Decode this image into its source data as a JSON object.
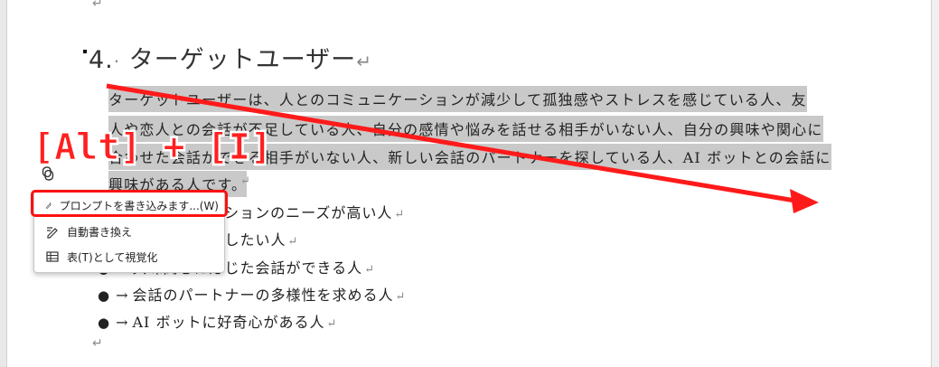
{
  "document": {
    "top_return_mark": "↵",
    "heading": {
      "number": "4.",
      "separator": "·",
      "text": "ターゲットユーザー",
      "return_mark": "↵"
    },
    "paragraph_lines": [
      "ターゲットユーザーは、人とのコミュニケーションが減少して孤独感やストレスを感じている人、友",
      "人や恋人との会話が不足している人、自分の感情や悩みを話せる相手がいない人、自分の興味や関心に",
      "合わせた会話ができる相手がいない人、新しい会話のパートナーを探している人、AI ボットとの会話に",
      "興味がある人です。"
    ],
    "paragraph_end_mark": "↵",
    "list_items": [
      {
        "bullet": "●",
        "arrow": "→",
        "text": "コミュニケーションのニーズが高い人",
        "ret": "↵"
      },
      {
        "bullet": "●",
        "arrow": "→",
        "text": "気持ちを共有したい人",
        "ret": "↵"
      },
      {
        "bullet": "●",
        "arrow": "→",
        "text": "興味関心に応じた会話ができる人",
        "ret": "↵"
      },
      {
        "bullet": "●",
        "arrow": "→",
        "text": "会話のパートナーの多様性を求める人",
        "ret": "↵"
      },
      {
        "bullet": "●",
        "arrow": "→",
        "text": "AI ボットに好奇心がある人",
        "ret": "↵"
      }
    ],
    "bottom_return_mark": "↵"
  },
  "context_menu": {
    "items": [
      {
        "label": "プロンプトを書き込みます...(W)",
        "icon": "pen-sparkle-icon"
      },
      {
        "label": "自動書き換え",
        "icon": "pen-rewrite-icon"
      },
      {
        "label": "表(T)として視覚化",
        "icon": "table-icon"
      }
    ]
  },
  "annotation": {
    "shortcut": "[Alt] + [I]",
    "color": "#ff2020"
  }
}
